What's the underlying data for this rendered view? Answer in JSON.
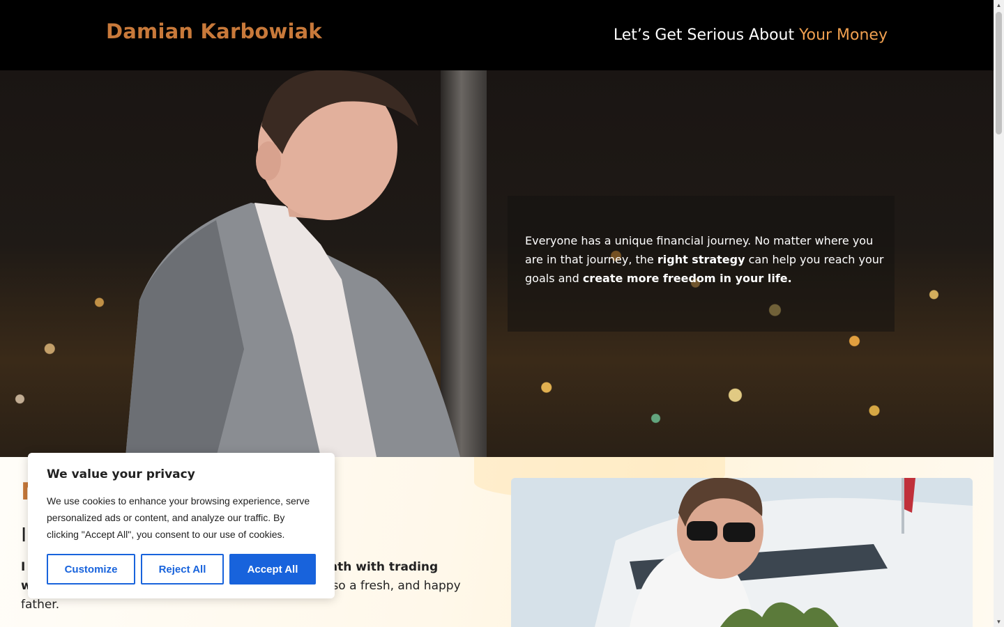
{
  "header": {
    "logo": "Damian Karbowiak",
    "tagline_prefix": "Let’s Get Serious About ",
    "tagline_accent": "Your Money"
  },
  "hero": {
    "text_1": "Everyone has a unique financial journey. No matter where you are in that journey, the ",
    "bold_1": "right strategy",
    "text_2": " can help you reach your goals and ",
    "bold_2": "create more freedom in your life."
  },
  "section": {
    "heading_visible": "M",
    "subheading_visible": "I",
    "body_line1_start": "I",
    "body_line1_bold_end": "onth with trading",
    "body_line2_start": "w",
    "body_line2_end": "lso a fresh, and happy",
    "body_line3": "father."
  },
  "cookie": {
    "title": "We value your privacy",
    "text": "We use cookies to enhance your browsing experience, serve personalized ads or content, and analyze our traffic. By clicking \"Accept All\", you consent to our use of cookies.",
    "customize_label": "Customize",
    "reject_label": "Reject All",
    "accept_label": "Accept All"
  },
  "colors": {
    "brand": "#c8793a",
    "accent": "#f0a050",
    "cookie_button": "#1863dc"
  },
  "icons": {
    "scroll_up": "chevron-up-icon",
    "scroll_down": "chevron-down-icon"
  }
}
